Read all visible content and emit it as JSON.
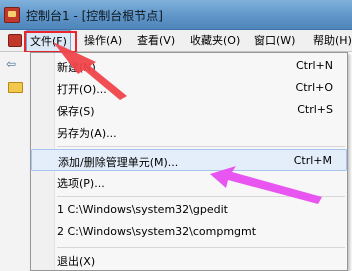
{
  "window": {
    "title": "控制台1 - [控制台根节点]"
  },
  "menubar": {
    "items": [
      {
        "label": "文件(F)"
      },
      {
        "label": "操作(A)"
      },
      {
        "label": "查看(V)"
      },
      {
        "label": "收藏夹(O)"
      },
      {
        "label": "窗口(W)"
      },
      {
        "label": "帮助(H)"
      }
    ]
  },
  "file_menu": {
    "new": {
      "label": "新建(N)",
      "shortcut": "Ctrl+N"
    },
    "open": {
      "label": "打开(O)...",
      "shortcut": "Ctrl+O"
    },
    "save": {
      "label": "保存(S)",
      "shortcut": "Ctrl+S"
    },
    "save_as": {
      "label": "另存为(A)..."
    },
    "add_remove_snapin": {
      "label": "添加/删除管理单元(M)...",
      "shortcut": "Ctrl+M"
    },
    "options": {
      "label": "选项(P)..."
    },
    "recent1": {
      "label": "1 C:\\Windows\\system32\\gpedit"
    },
    "recent2": {
      "label": "2 C:\\Windows\\system32\\compmgmt"
    },
    "exit": {
      "label": "退出(X)"
    }
  },
  "colors": {
    "highlight": "#e8262c",
    "arrow_red": "#f0454a",
    "arrow_magenta": "#e84cf0"
  }
}
